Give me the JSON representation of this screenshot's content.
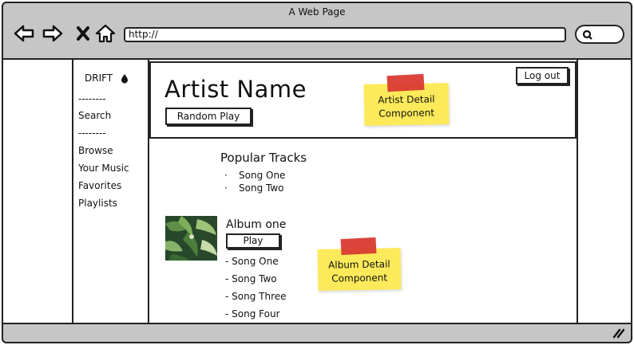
{
  "window": {
    "title": "A Web Page"
  },
  "toolbar": {
    "url": "http://"
  },
  "sidebar": {
    "brand": "DRIFT",
    "divider1": "--------",
    "search": "Search",
    "divider2": "--------",
    "items": [
      "Browse",
      "Your Music",
      "Favorites",
      "Playlists"
    ]
  },
  "header": {
    "artist_name": "Artist Name",
    "random_play": "Random Play",
    "logout": "Log out",
    "note_line1": "Artist Detail",
    "note_line2": "Component"
  },
  "popular": {
    "title": "Popular Tracks",
    "bullet": "·",
    "tracks": [
      "Song One",
      "Song Two"
    ]
  },
  "album": {
    "title": "Album one",
    "play": "Play",
    "tracks": [
      "- Song One",
      "- Song Two",
      "- Song Three",
      "- Song Four"
    ],
    "note_line1": "Album Detail",
    "note_line2": "Component"
  },
  "icons": {
    "back": "arrow-left-icon",
    "forward": "arrow-right-icon",
    "stop": "close-icon",
    "home": "home-icon",
    "search": "search-icon",
    "brand": "drop-icon",
    "resize": "resize-grip-icon"
  },
  "colors": {
    "chrome": "#c6c6c6",
    "sticky": "#fcea5a",
    "tape": "#d93b32"
  }
}
